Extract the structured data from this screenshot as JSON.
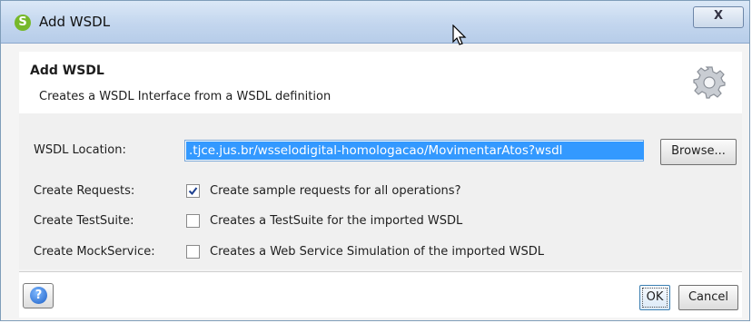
{
  "window": {
    "title": "Add WSDL",
    "app_icon_letter": "S",
    "close_glyph": "X"
  },
  "header": {
    "title": "Add WSDL",
    "description": "Creates a WSDL Interface from a WSDL definition",
    "icon": "gear-icon"
  },
  "form": {
    "wsdl_location_label": "WSDL Location:",
    "wsdl_location_value": ".tjce.jus.br/wsselodigital-homologacao/MovimentarAtos?wsdl",
    "browse_label": "Browse...",
    "create_requests_label": "Create Requests:",
    "create_requests_text": "Create sample requests for all operations?",
    "create_requests_checked": true,
    "create_testsuite_label": "Create TestSuite:",
    "create_testsuite_text": "Creates a TestSuite for the imported WSDL",
    "create_testsuite_checked": false,
    "create_mockservice_label": "Create MockService:",
    "create_mockservice_text": "Creates a Web Service Simulation of the imported WSDL",
    "create_mockservice_checked": false
  },
  "footer": {
    "help_glyph": "?",
    "ok_label": "OK",
    "cancel_label": "Cancel"
  },
  "colors": {
    "selection": "#3399ff",
    "titlebar": "#c3d6ee",
    "app_icon": "#76b82a"
  }
}
